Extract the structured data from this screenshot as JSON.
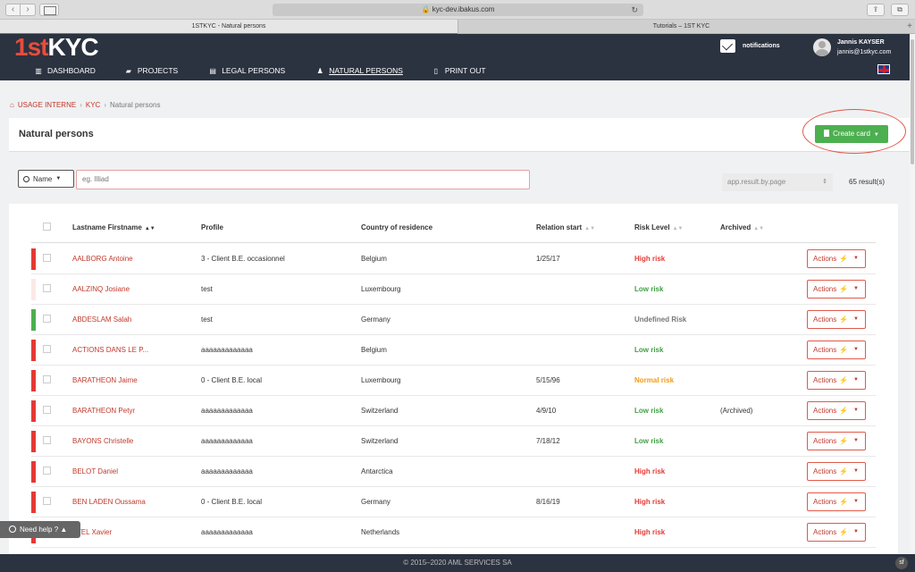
{
  "browser": {
    "url": "kyc-dev.ibakus.com",
    "tabs": [
      {
        "title": "1STKYC - Natural persons"
      },
      {
        "title": "Tutorials – 1ST KYC"
      }
    ]
  },
  "logo": {
    "part1": "1st",
    "part2": "KYC"
  },
  "header": {
    "notifications": "notifications",
    "user_name": "Jannis KAYSER",
    "user_email": "jannis@1stkyc.com"
  },
  "nav": [
    {
      "label": "DASHBOARD",
      "icon": "chart-icon"
    },
    {
      "label": "PROJECTS",
      "icon": "folder-icon"
    },
    {
      "label": "LEGAL PERSONS",
      "icon": "building-icon"
    },
    {
      "label": "NATURAL PERSONS",
      "icon": "user-icon"
    },
    {
      "label": "PRINT OUT",
      "icon": "file-icon"
    }
  ],
  "breadcrumb": {
    "items": [
      "USAGE INTERNE",
      "KYC"
    ],
    "current": "Natural persons"
  },
  "page": {
    "title": "Natural persons",
    "create_label": "Create card"
  },
  "filters": {
    "field": "Name",
    "placeholder": "eg. Illiad",
    "per_page": "app.result.by.page",
    "results": "65 result(s)"
  },
  "columns": [
    "Lastname Firstname",
    "Profile",
    "Country of residence",
    "Relation start",
    "Risk Level",
    "Archived"
  ],
  "colors": {
    "high": "#e53935",
    "low": "#43a047",
    "normal": "#f39c12",
    "undefined": "#777777",
    "bar_red": "#e53935",
    "bar_green": "#4caf50",
    "bar_light": "#fbe9e7"
  },
  "rows": [
    {
      "name": "AALBORG Antoine",
      "profile": "3 - Client B.E. occasionnel",
      "country": "Belgium",
      "start": "1/25/17",
      "risk": "High risk",
      "risk_type": "high",
      "archived": "",
      "bar": "bar_red"
    },
    {
      "name": "AALZINQ Josiane",
      "profile": "test",
      "country": "Luxembourg",
      "start": "",
      "risk": "Low risk",
      "risk_type": "low",
      "archived": "",
      "bar": "bar_light"
    },
    {
      "name": "ABDESLAM Salah",
      "profile": "test",
      "country": "Germany",
      "start": "",
      "risk": "Undefined Risk",
      "risk_type": "undefined",
      "archived": "",
      "bar": "bar_green"
    },
    {
      "name": "ACTIONS DANS LE P...",
      "profile": "aaaaaaaaaaaaa",
      "country": "Belgium",
      "start": "",
      "risk": "Low risk",
      "risk_type": "low",
      "archived": "",
      "bar": "bar_red"
    },
    {
      "name": "BARATHEON Jaime",
      "profile": "0 - Client B.E. local",
      "country": "Luxembourg",
      "start": "5/15/96",
      "risk": "Normal risk",
      "risk_type": "normal",
      "archived": "",
      "bar": "bar_red"
    },
    {
      "name": "BARATHEON Petyr",
      "profile": "aaaaaaaaaaaaa",
      "country": "Switzerland",
      "start": "4/9/10",
      "risk": "Low risk",
      "risk_type": "low",
      "archived": "(Archived)",
      "bar": "bar_red"
    },
    {
      "name": "BAYONS Christelle",
      "profile": "aaaaaaaaaaaaa",
      "country": "Switzerland",
      "start": "7/18/12",
      "risk": "Low risk",
      "risk_type": "low",
      "archived": "",
      "bar": "bar_red"
    },
    {
      "name": "BELOT Daniel",
      "profile": "aaaaaaaaaaaaa",
      "country": "Antarctica",
      "start": "",
      "risk": "High risk",
      "risk_type": "high",
      "archived": "",
      "bar": "bar_red"
    },
    {
      "name": "BEN LADEN Oussama",
      "profile": "0 - Client B.E. local",
      "country": "Germany",
      "start": "8/16/19",
      "risk": "High risk",
      "risk_type": "high",
      "archived": "",
      "bar": "bar_red"
    },
    {
      "name": "TTEL Xavier",
      "profile": "aaaaaaaaaaaaa",
      "country": "Netherlands",
      "start": "",
      "risk": "High risk",
      "risk_type": "high",
      "archived": "",
      "bar": "bar_red"
    }
  ],
  "actions_label": "Actions",
  "help": "Need help ?",
  "footer": "© 2015–2020 AML SERVICES SA"
}
